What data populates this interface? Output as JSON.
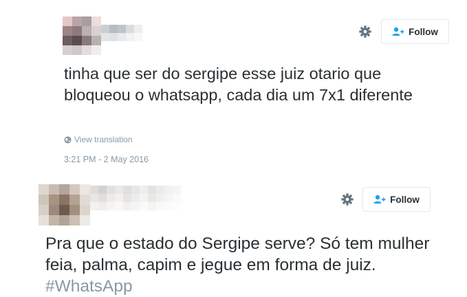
{
  "tweets": [
    {
      "text": "tinha que ser do sergipe esse juiz otario que bloqueou o whatsapp, cada dia um 7x1 diferente",
      "translate_label": "View translation",
      "timestamp": "3:21 PM - 2 May 2016",
      "follow_label": "Follow"
    },
    {
      "text": "Pra que o estado do Sergipe serve? Só tem mulher feia, palma, capim e jegue em forma de juiz.",
      "hashtag": "#WhatsApp",
      "follow_label": "Follow"
    }
  ],
  "colors": {
    "text": "#292f33",
    "muted": "#8899a6",
    "hashtag": "#8899a6",
    "button_border": "#e1e8ed",
    "follow_icon": "#1da1f2"
  },
  "icons": {
    "settings": "gear-icon",
    "follow": "follow-person-icon",
    "translate": "globe-icon"
  }
}
